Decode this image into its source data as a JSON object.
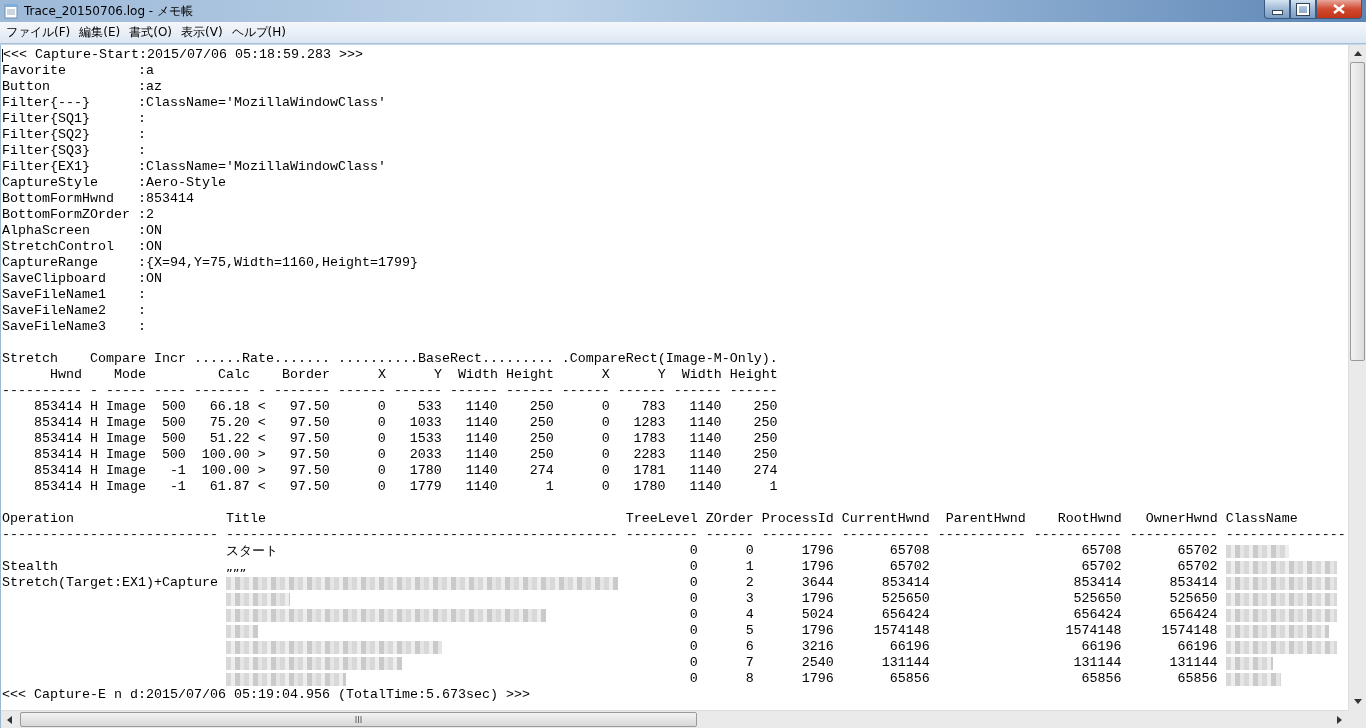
{
  "window": {
    "title": "Trace_20150706.log - メモ帳"
  },
  "menu": [
    "ファイル(F)",
    "編集(E)",
    "書式(O)",
    "表示(V)",
    "ヘルプ(H)"
  ],
  "log": {
    "start_line": "<<< Capture-Start:2015/07/06 05:18:59.283 >>>",
    "settings": [
      {
        "key": "Favorite",
        "value": ":a"
      },
      {
        "key": "Button",
        "value": ":az"
      },
      {
        "key": "Filter{---}",
        "value": ":ClassName='MozillaWindowClass'"
      },
      {
        "key": "Filter{SQ1}",
        "value": ":"
      },
      {
        "key": "Filter{SQ2}",
        "value": ":"
      },
      {
        "key": "Filter{SQ3}",
        "value": ":"
      },
      {
        "key": "Filter{EX1}",
        "value": ":ClassName='MozillaWindowClass'"
      },
      {
        "key": "CaptureStyle",
        "value": ":Aero-Style"
      },
      {
        "key": "BottomFormHwnd",
        "value": ":853414"
      },
      {
        "key": "BottomFormZOrder",
        "value": ":2"
      },
      {
        "key": "AlphaScreen",
        "value": ":ON"
      },
      {
        "key": "StretchControl",
        "value": ":ON"
      },
      {
        "key": "CaptureRange",
        "value": ":{X=94,Y=75,Width=1160,Height=1799}"
      },
      {
        "key": "SaveClipboard",
        "value": ":ON"
      },
      {
        "key": "SaveFileName1",
        "value": ":"
      },
      {
        "key": "SaveFileName2",
        "value": ":"
      },
      {
        "key": "SaveFileName3",
        "value": ":"
      }
    ],
    "rect_table": {
      "header_lines": [
        "Stretch    Compare Incr ......Rate....... ..........BaseRect......... .CompareRect(Image-M-Only).",
        "      Hwnd    Mode         Calc    Border      X      Y  Width Height      X      Y  Width Height",
        "---------- - ----- ---- ------- - ------- ------ ------ ------ ------ ------ ------ ------ ------"
      ],
      "rows": [
        [
          "853414",
          "H",
          "Image",
          "500",
          "66.18",
          "<",
          "97.50",
          "0",
          "533",
          "1140",
          "250",
          "0",
          "783",
          "1140",
          "250"
        ],
        [
          "853414",
          "H",
          "Image",
          "500",
          "75.20",
          "<",
          "97.50",
          "0",
          "1033",
          "1140",
          "250",
          "0",
          "1283",
          "1140",
          "250"
        ],
        [
          "853414",
          "H",
          "Image",
          "500",
          "51.22",
          "<",
          "97.50",
          "0",
          "1533",
          "1140",
          "250",
          "0",
          "1783",
          "1140",
          "250"
        ],
        [
          "853414",
          "H",
          "Image",
          "500",
          "100.00",
          ">",
          "97.50",
          "0",
          "2033",
          "1140",
          "250",
          "0",
          "2283",
          "1140",
          "250"
        ],
        [
          "853414",
          "H",
          "Image",
          "-1",
          "100.00",
          ">",
          "97.50",
          "0",
          "1780",
          "1140",
          "274",
          "0",
          "1781",
          "1140",
          "274"
        ],
        [
          "853414",
          "H",
          "Image",
          "-1",
          "61.87",
          "<",
          "97.50",
          "0",
          "1779",
          "1140",
          "1",
          "0",
          "1780",
          "1140",
          "1"
        ]
      ]
    },
    "window_table": {
      "header_lines": [
        "Operation                   Title                                             TreeLevel ZOrder ProcessId CurrentHwnd  ParentHwnd    RootHwnd   OwnerHwnd ClassName",
        "--------------------------- ------------------------------------------------- --------- ------ --------- ----------- ----------- ----------- ----------- ---------------"
      ],
      "rows": [
        {
          "operation": "",
          "title": "スタート",
          "title_blurred": false,
          "cells": [
            "0",
            "0",
            "1796",
            "65708",
            "",
            "65708",
            "65702"
          ],
          "class_blurred": true
        },
        {
          "operation": "Stealth",
          "title": "„„„",
          "title_blurred": false,
          "cells": [
            "0",
            "1",
            "1796",
            "65702",
            "",
            "65702",
            "65702"
          ],
          "class_blurred": true
        },
        {
          "operation": "Stretch(Target:EX1)+Capture",
          "title": "",
          "title_blurred": true,
          "cells": [
            "0",
            "2",
            "3644",
            "853414",
            "",
            "853414",
            "853414"
          ],
          "class_blurred": true
        },
        {
          "operation": "",
          "title": "",
          "title_blurred": true,
          "cells": [
            "0",
            "3",
            "1796",
            "525650",
            "",
            "525650",
            "525650"
          ],
          "class_blurred": true
        },
        {
          "operation": "",
          "title": "",
          "title_blurred": true,
          "cells": [
            "0",
            "4",
            "5024",
            "656424",
            "",
            "656424",
            "656424"
          ],
          "class_blurred": true
        },
        {
          "operation": "",
          "title": "",
          "title_blurred": true,
          "cells": [
            "0",
            "5",
            "1796",
            "1574148",
            "",
            "1574148",
            "1574148"
          ],
          "class_blurred": true
        },
        {
          "operation": "",
          "title": "",
          "title_blurred": true,
          "cells": [
            "0",
            "6",
            "3216",
            "66196",
            "",
            "66196",
            "66196"
          ],
          "class_blurred": true
        },
        {
          "operation": "",
          "title": "",
          "title_blurred": true,
          "cells": [
            "0",
            "7",
            "2540",
            "131144",
            "",
            "131144",
            "131144"
          ],
          "class_blurred": true
        },
        {
          "operation": "",
          "title": "",
          "title_blurred": true,
          "cells": [
            "0",
            "8",
            "1796",
            "65856",
            "",
            "65856",
            "65856"
          ],
          "class_blurred": true
        }
      ]
    },
    "end_line": "<<< Capture-E n d:2015/07/06 05:19:04.956 (TotalTime:5.673sec) >>>"
  }
}
